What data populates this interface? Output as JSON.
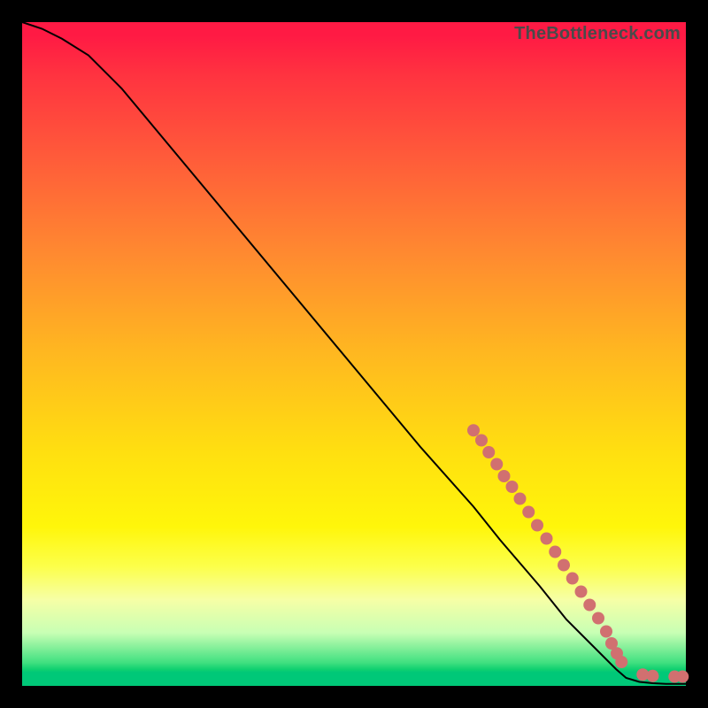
{
  "watermark": "TheBottleneck.com",
  "colors": {
    "point_fill": "#d17070",
    "line_stroke": "#000000",
    "frame_bg": "#000000"
  },
  "chart_data": {
    "type": "line",
    "title": "",
    "xlabel": "",
    "ylabel": "",
    "xlim": [
      0,
      100
    ],
    "ylim": [
      0,
      100
    ],
    "grid": false,
    "legend": false,
    "annotations": [
      "TheBottleneck.com"
    ],
    "series": [
      {
        "name": "curve",
        "x": [
          0,
          3,
          6,
          10,
          15,
          20,
          30,
          40,
          50,
          60,
          68,
          72,
          75,
          78,
          80,
          82,
          84,
          86,
          88,
          89.5,
          91,
          93,
          95,
          97,
          100
        ],
        "y": [
          100,
          99,
          97.5,
          95,
          90,
          84,
          72,
          60,
          48,
          36,
          27,
          22,
          18.5,
          15,
          12.5,
          10,
          8,
          6,
          4,
          2.5,
          1.2,
          0.6,
          0.4,
          0.3,
          0.3
        ]
      }
    ],
    "points": [
      {
        "x": 68.0,
        "y": 38.5
      },
      {
        "x": 69.2,
        "y": 37.0
      },
      {
        "x": 70.3,
        "y": 35.2
      },
      {
        "x": 71.5,
        "y": 33.4
      },
      {
        "x": 72.6,
        "y": 31.6
      },
      {
        "x": 73.8,
        "y": 30.0
      },
      {
        "x": 75.0,
        "y": 28.2
      },
      {
        "x": 76.3,
        "y": 26.2
      },
      {
        "x": 77.6,
        "y": 24.2
      },
      {
        "x": 79.0,
        "y": 22.2
      },
      {
        "x": 80.3,
        "y": 20.2
      },
      {
        "x": 81.6,
        "y": 18.2
      },
      {
        "x": 82.9,
        "y": 16.2
      },
      {
        "x": 84.2,
        "y": 14.2
      },
      {
        "x": 85.5,
        "y": 12.2
      },
      {
        "x": 86.8,
        "y": 10.2
      },
      {
        "x": 88.0,
        "y": 8.2
      },
      {
        "x": 88.8,
        "y": 6.4
      },
      {
        "x": 89.6,
        "y": 4.9
      },
      {
        "x": 90.3,
        "y": 3.6
      },
      {
        "x": 93.5,
        "y": 1.7
      },
      {
        "x": 95.0,
        "y": 1.5
      },
      {
        "x": 98.3,
        "y": 1.4
      },
      {
        "x": 99.5,
        "y": 1.4
      }
    ],
    "point_radius_px": 7
  }
}
